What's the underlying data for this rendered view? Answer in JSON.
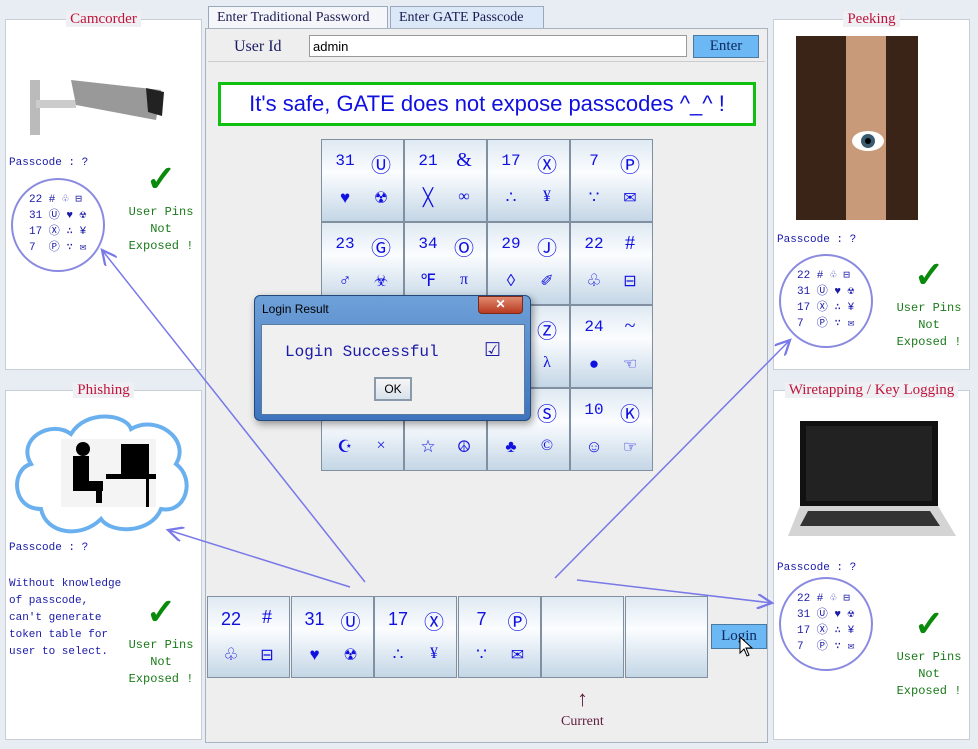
{
  "tabs": [
    {
      "label": "Enter Traditional Password"
    },
    {
      "label": "Enter GATE Passcode"
    }
  ],
  "userid": {
    "label": "User Id",
    "value": "admin",
    "enter": "Enter"
  },
  "message": "It's safe, GATE does not expose passcodes ^_^ !",
  "grid": [
    {
      "num": "31",
      "sym": "Ⓤ",
      "b1": "♥",
      "b2": "☢"
    },
    {
      "num": "21",
      "sym": "&",
      "b1": "╳",
      "b2": "∞"
    },
    {
      "num": "17",
      "sym": "Ⓧ",
      "b1": "∴",
      "b2": "¥"
    },
    {
      "num": "7",
      "sym": "Ⓟ",
      "b1": "∵",
      "b2": "✉"
    },
    {
      "num": "23",
      "sym": "Ⓖ",
      "b1": "♂",
      "b2": "☣"
    },
    {
      "num": "34",
      "sym": "Ⓞ",
      "b1": "℉",
      "b2": "π"
    },
    {
      "num": "29",
      "sym": "Ⓙ",
      "b1": "◊",
      "b2": "✐"
    },
    {
      "num": "22",
      "sym": "#",
      "b1": "♧",
      "b2": "⊟"
    },
    {
      "num": "",
      "sym": "",
      "b1": "",
      "b2": ""
    },
    {
      "num": "",
      "sym": "",
      "b1": "",
      "b2": ""
    },
    {
      "num": "",
      "sym": "Ⓩ",
      "b1": "",
      "b2": "λ"
    },
    {
      "num": "24",
      "sym": "~",
      "b1": "●",
      "b2": "☜"
    },
    {
      "num": "",
      "sym": "",
      "b1": "☪",
      "b2": "×"
    },
    {
      "num": "",
      "sym": "",
      "b1": "☆",
      "b2": "☮"
    },
    {
      "num": "",
      "sym": "Ⓢ",
      "b1": "♣",
      "b2": "©"
    },
    {
      "num": "10",
      "sym": "Ⓚ",
      "b1": "☺",
      "b2": "☞"
    }
  ],
  "selected": [
    {
      "num": "22",
      "sym": "#",
      "b1": "♧",
      "b2": "⊟"
    },
    {
      "num": "31",
      "sym": "Ⓤ",
      "b1": "♥",
      "b2": "☢"
    },
    {
      "num": "17",
      "sym": "Ⓧ",
      "b1": "∴",
      "b2": "¥"
    },
    {
      "num": "7",
      "sym": "Ⓟ",
      "b1": "∵",
      "b2": "✉"
    },
    {
      "num": "",
      "sym": "",
      "b1": "",
      "b2": ""
    },
    {
      "num": "",
      "sym": "",
      "b1": "",
      "b2": ""
    }
  ],
  "login": "Login",
  "current": {
    "arrow": "↑",
    "label": "Current"
  },
  "dialog": {
    "title": "Login Result",
    "close": "✕",
    "message": "Login Successful",
    "check": "☑",
    "ok": "OK"
  },
  "panels": {
    "camcorder": {
      "title": "Camcorder",
      "passcode": "Passcode : ?",
      "circle": "22 # ♧ ⊟\n31 Ⓤ ♥ ☢\n17 Ⓧ ∴ ¥\n7  Ⓟ ∵ ✉",
      "check": "✓",
      "pins": "User Pins\nNot\nExposed !"
    },
    "phishing": {
      "title": "Phishing",
      "passcode": "Passcode : ?",
      "note": "Without knowledge\nof passcode,\ncan't generate\ntoken table for\nuser to select.",
      "check": "✓",
      "pins": "User Pins\nNot\nExposed !"
    },
    "peeking": {
      "title": "Peeking",
      "passcode": "Passcode : ?",
      "circle": "22 # ♧ ⊟\n31 Ⓤ ♥ ☢\n17 Ⓧ ∴ ¥\n7  Ⓟ ∵ ✉",
      "check": "✓",
      "pins": "User Pins\nNot\nExposed !"
    },
    "wiretap": {
      "title": "Wiretapping / Key Logging",
      "passcode": "Passcode : ?",
      "circle": "22 # ♧ ⊟\n31 Ⓤ ♥ ☢\n17 Ⓧ ∴ ¥\n7  Ⓟ ∵ ✉",
      "check": "✓",
      "pins": "User Pins\nNot\nExposed !"
    }
  },
  "colors": {
    "accent": "#1010e0",
    "title": "#c0143c",
    "ok": "#1a7a1a",
    "button": "#6cb8f5"
  }
}
